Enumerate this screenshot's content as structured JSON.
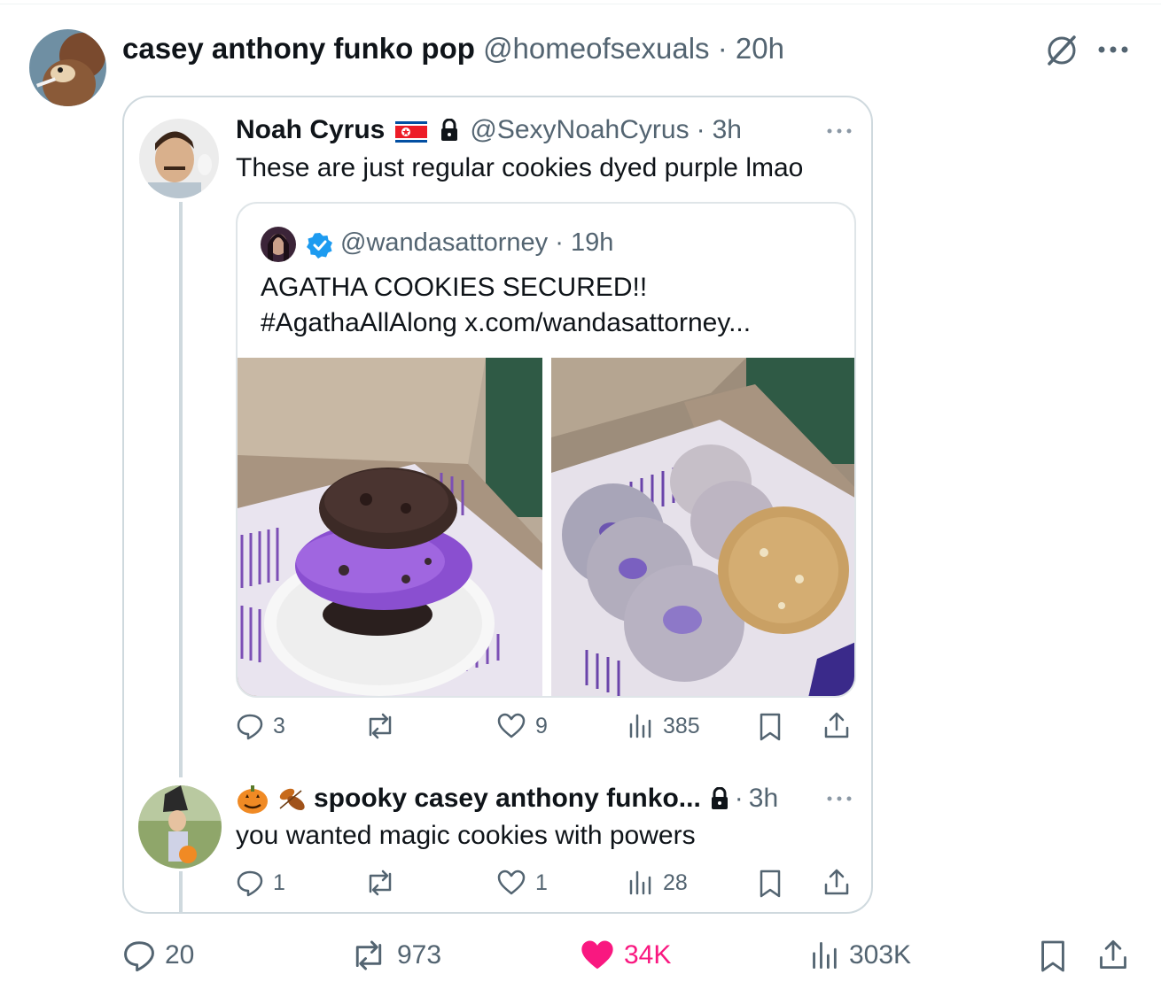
{
  "main_post": {
    "display_name": "casey anthony funko pop",
    "handle": "@homeofsexuals",
    "separator": "·",
    "time": "20h",
    "more_icon": "more-icon",
    "grok_icon": "grok-icon",
    "stats": {
      "replies": "20",
      "reposts": "973",
      "likes": "34K",
      "views": "303K"
    },
    "like_color": "#f91880"
  },
  "quoted_post": {
    "display_name": "Noah Cyrus",
    "handle": "@SexyNoahCyrus",
    "separator": "·",
    "time": "3h",
    "text": "These are just regular cookies dyed purple lmao",
    "stats": {
      "replies": "3",
      "reposts": "",
      "likes": "9",
      "views": "385"
    }
  },
  "nested_quote": {
    "handle": "@wandasattorney",
    "separator": "·",
    "time": "19h",
    "line1": "AGATHA COOKIES SECURED!!",
    "line2": "#AgathaAllAlong x.com/wandasattorney...",
    "verified_color": "#1d9bf0",
    "images": [
      {
        "description_icon": "ice-cream-sandwich-photo"
      },
      {
        "description_icon": "purple-cookies-box-photo"
      }
    ]
  },
  "reply_post": {
    "display_name": "spooky casey anthony funko...",
    "separator": "·",
    "time": "3h",
    "text": "you wanted magic cookies with powers",
    "stats": {
      "replies": "1",
      "reposts": "",
      "likes": "1",
      "views": "28"
    }
  },
  "colors": {
    "muted": "#536471",
    "border": "#cfd9de",
    "like": "#f91880"
  }
}
